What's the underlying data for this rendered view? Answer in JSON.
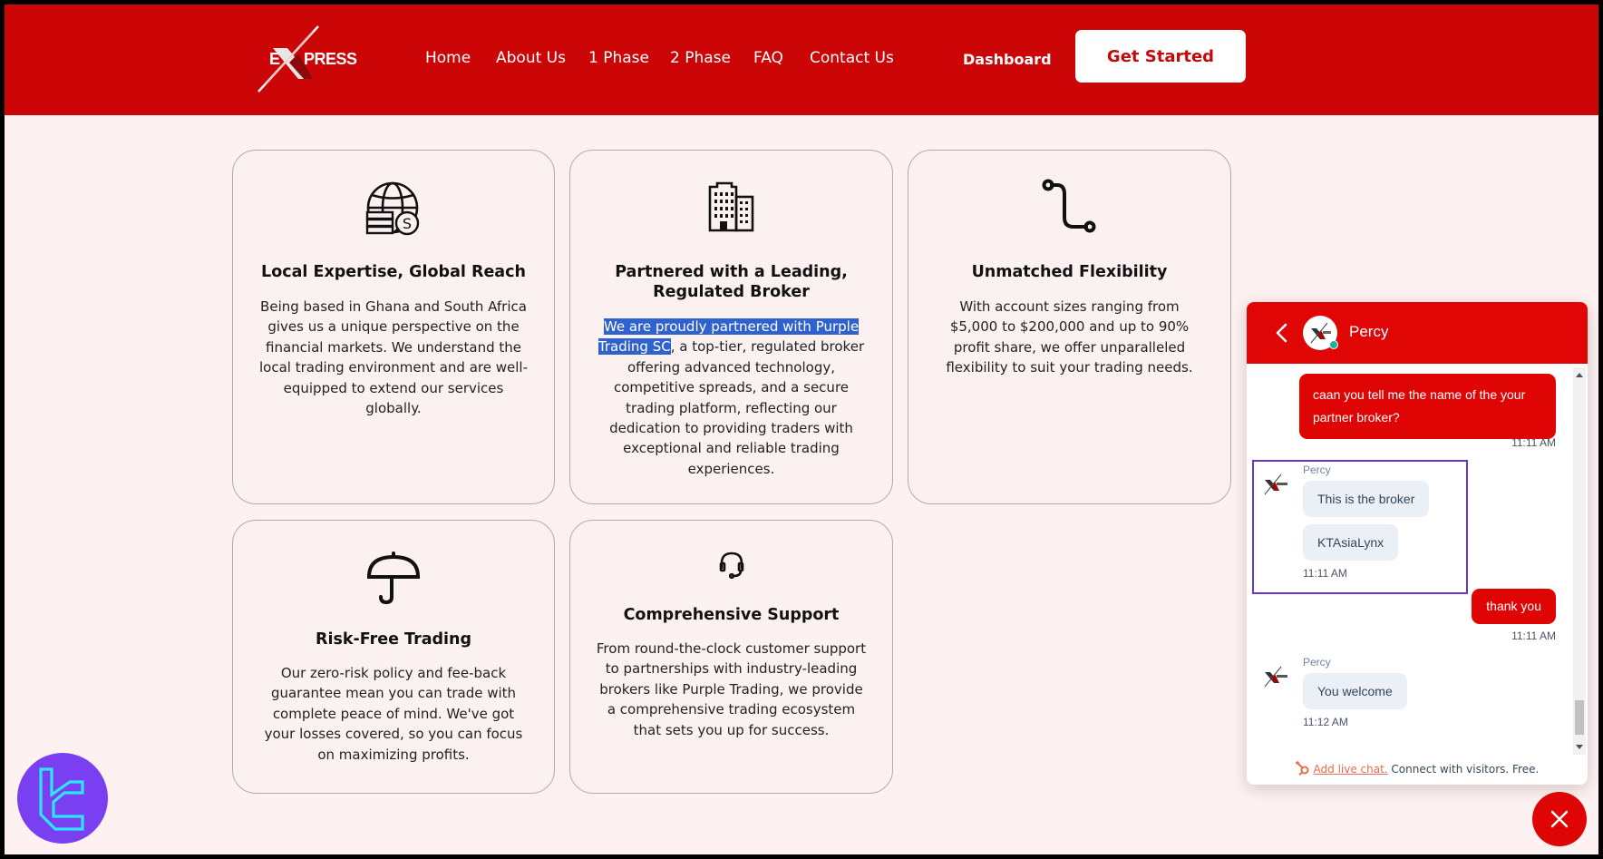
{
  "header": {
    "logo_text_left": "E",
    "logo_text_right": "PRESS",
    "nav": [
      {
        "label": "Home"
      },
      {
        "label": "About Us"
      },
      {
        "label": "1 Phase"
      },
      {
        "label": "2 Phase"
      },
      {
        "label": "FAQ"
      },
      {
        "label": "Contact Us"
      }
    ],
    "dashboard_label": "Dashboard",
    "cta_label": "Get Started"
  },
  "features": [
    {
      "icon": "globe-dollar-icon",
      "title": "Local Expertise, Global Reach",
      "body": "Being based in Ghana and South Africa gives us a unique perspective on the financial markets. We understand the local trading environment and are well-equipped to extend our services globally."
    },
    {
      "icon": "buildings-icon",
      "title": "Partnered with a Leading, Regulated Broker",
      "body_highlighted": "We are proudly partnered with Purple Trading SC",
      "body_rest": ", a top-tier, regulated broker offering advanced technology, competitive spreads, and a secure trading platform, reflecting our dedication to providing traders with exceptional and reliable trading experiences."
    },
    {
      "icon": "route-icon",
      "title": "Unmatched Flexibility",
      "body": "With account sizes ranging from $5,000 to $200,000 and up to 90% profit share, we offer unparalleled flexibility to suit your trading needs."
    },
    {
      "icon": "umbrella-icon",
      "title": "Risk-Free Trading",
      "body": "Our zero-risk policy and fee-back guarantee mean you can trade with complete peace of mind. We've got your losses covered, so you can focus on maximizing profits."
    },
    {
      "icon": "headset-icon",
      "title": "Comprehensive Support",
      "body": "From round-the-clock customer support to partnerships with industry-leading brokers like Purple Trading, we provide a comprehensive trading ecosystem that sets you up for success."
    }
  ],
  "chat": {
    "agent_name": "Percy",
    "messages": [
      {
        "from": "user",
        "text": "caan you tell me the name of the your partner broker?",
        "time": "11:11 AM"
      },
      {
        "from": "agent",
        "sender": "Percy",
        "texts": [
          "This is the broker",
          "KTAsiaLynx"
        ],
        "time": "11:11 AM"
      },
      {
        "from": "user",
        "text": "thank you",
        "time": "11:11 AM"
      },
      {
        "from": "agent",
        "sender": "Percy",
        "texts": [
          "You welcome"
        ],
        "time": "11:12 AM"
      }
    ],
    "footer_link": "Add live chat.",
    "footer_text": " Connect with visitors. Free."
  },
  "colors": {
    "brand_red": "#cc0606",
    "chat_red": "#e00505",
    "page_bg": "#fdf1f1",
    "selection_blue": "#2f62cf",
    "bubble_purple": "#7b3ff2"
  }
}
